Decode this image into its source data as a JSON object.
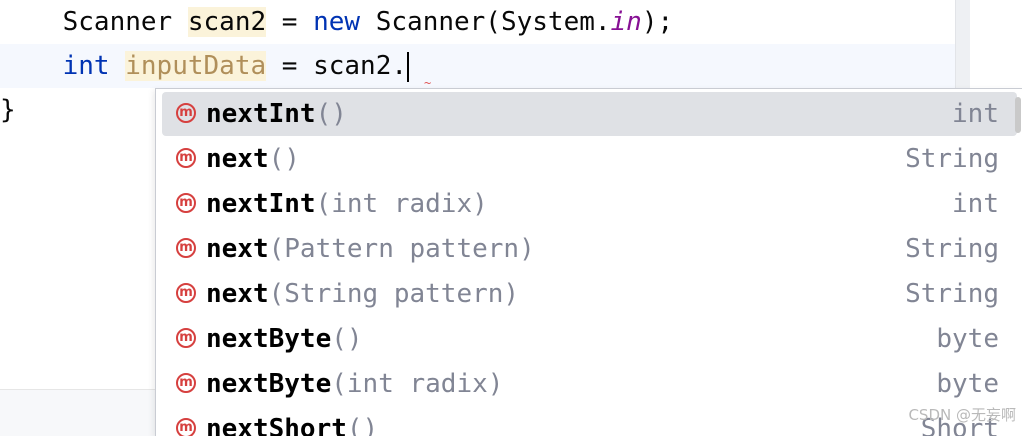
{
  "editor": {
    "line1": {
      "indent": "    ",
      "type": "Scanner",
      "var": "scan2",
      "eq": " = ",
      "kw_new": "new",
      "ctor": " Scanner(System.",
      "static_field": "in",
      "tail": ");"
    },
    "line2": {
      "indent": "    ",
      "kw_int": "int",
      "var": "inputData",
      "rest": " = scan2."
    },
    "line3": {
      "brace": "}"
    }
  },
  "completion": {
    "icon_glyph": "m",
    "items": [
      {
        "name": "nextInt",
        "params": "()",
        "return": "int",
        "selected": true
      },
      {
        "name": "next",
        "params": "()",
        "return": "String",
        "selected": false
      },
      {
        "name": "nextInt",
        "params": "(int radix)",
        "return": "int",
        "selected": false
      },
      {
        "name": "next",
        "params": "(Pattern pattern)",
        "return": "String",
        "selected": false
      },
      {
        "name": "next",
        "params": "(String pattern)",
        "return": "String",
        "selected": false
      },
      {
        "name": "nextByte",
        "params": "()",
        "return": "byte",
        "selected": false
      },
      {
        "name": "nextByte",
        "params": "(int radix)",
        "return": "byte",
        "selected": false
      },
      {
        "name": "nextShort",
        "params": "()",
        "return": "Short",
        "selected": false
      }
    ]
  },
  "watermark": "CSDN @无妄啊",
  "colors": {
    "keyword": "#0033b3",
    "static_field": "#871094",
    "method_icon": "#d6403f",
    "selection": "#dfe1e5",
    "param_gray": "#818594"
  }
}
